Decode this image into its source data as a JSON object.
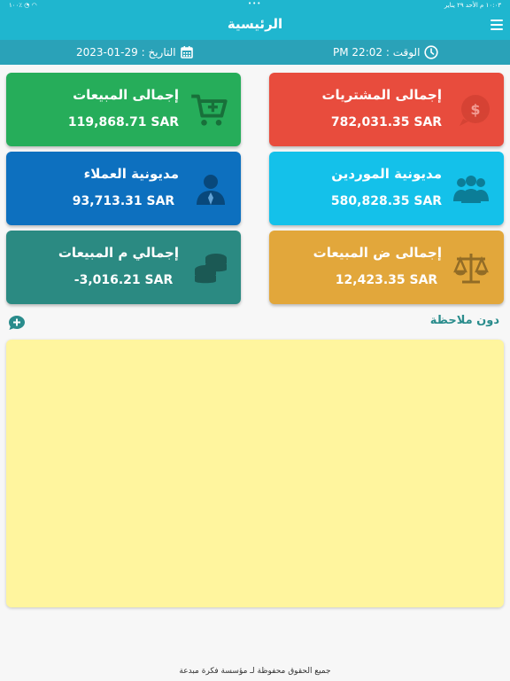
{
  "status_bar": {
    "time": "١٠:٠٣ م",
    "date": "الأحد ٢٩ يناير",
    "battery": "١٠٠٪",
    "dots": "•••"
  },
  "header": {
    "title": "الرئيسية"
  },
  "info": {
    "date_text": "التاريخ : 29-01-2023",
    "time_text": "الوقت : 22:02 PM"
  },
  "cards": [
    {
      "label": "إجمالى المبيعات",
      "value": "119,868.71 SAR",
      "color": "#26ad5a",
      "icon": "cart-icon"
    },
    {
      "label": "إجمالى المشتريات",
      "value": "782,031.35 SAR",
      "color": "#e84c3d",
      "icon": "money-bubble-icon"
    },
    {
      "label": "مديونية العملاء",
      "value": "93,713.31 SAR",
      "color": "#0d70bf",
      "icon": "customer-icon"
    },
    {
      "label": "مديونية الموردين",
      "value": "580,828.35 SAR",
      "color": "#14c1ea",
      "icon": "suppliers-icon"
    },
    {
      "label": "إجمالي م المبيعات",
      "value": "-3,016.21 SAR",
      "color": "#2b8a82",
      "icon": "coins-icon"
    },
    {
      "label": "إجمالى ض المبيعات",
      "value": "12,423.35 SAR",
      "color": "#e2a73b",
      "icon": "scale-icon"
    }
  ],
  "notes": {
    "title": "دون ملاحظة",
    "content": ""
  },
  "footer": {
    "text": "جميع الحقوق محفوظة لـ مؤسسة فكرة مبدعة"
  }
}
